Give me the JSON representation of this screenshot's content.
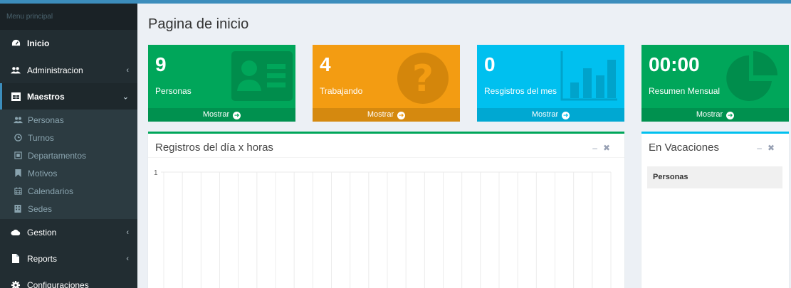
{
  "sidebar": {
    "header": "Menu principal",
    "items": [
      {
        "label": "Inicio",
        "icon": "dashboard-icon"
      },
      {
        "label": "Administracion",
        "icon": "users-icon"
      },
      {
        "label": "Maestros",
        "icon": "table-icon"
      },
      {
        "label": "Gestion",
        "icon": "cloud-icon"
      },
      {
        "label": "Reports",
        "icon": "file-icon"
      },
      {
        "label": "Configuraciones",
        "icon": "gear-icon"
      }
    ],
    "submenu": [
      {
        "label": "Personas",
        "icon": "users-icon"
      },
      {
        "label": "Turnos",
        "icon": "clock-icon"
      },
      {
        "label": "Departamentos",
        "icon": "square-icon"
      },
      {
        "label": "Motivos",
        "icon": "bookmark-icon"
      },
      {
        "label": "Calendarios",
        "icon": "calendar-icon"
      },
      {
        "label": "Sedes",
        "icon": "building-icon"
      }
    ]
  },
  "page": {
    "title": "Pagina de inicio"
  },
  "stats": [
    {
      "value": "9",
      "label": "Personas",
      "footer": "Mostrar",
      "color": "#00a65a",
      "icon": "id-card-icon"
    },
    {
      "value": "4",
      "label": "Trabajando",
      "footer": "Mostrar",
      "color": "#f39c12",
      "icon": "question-circle-icon"
    },
    {
      "value": "0",
      "label": "Resgistros del mes",
      "footer": "Mostrar",
      "color": "#00c0ef",
      "icon": "bar-chart-icon"
    },
    {
      "value": "00:00",
      "label": "Resumen Mensual",
      "footer": "Mostrar",
      "color": "#00a65a",
      "icon": "pie-chart-icon"
    }
  ],
  "chart_box": {
    "title": "Registros del día x horas",
    "border_color": "#00a65a"
  },
  "vacations_box": {
    "title": "En Vacaciones",
    "column_header": "Personas",
    "border_color": "#00c0ef"
  },
  "chart_data": {
    "type": "line",
    "title": "",
    "xlabel": "",
    "ylabel": "",
    "y_ticks": [
      "1"
    ],
    "series": [],
    "grid": true
  }
}
